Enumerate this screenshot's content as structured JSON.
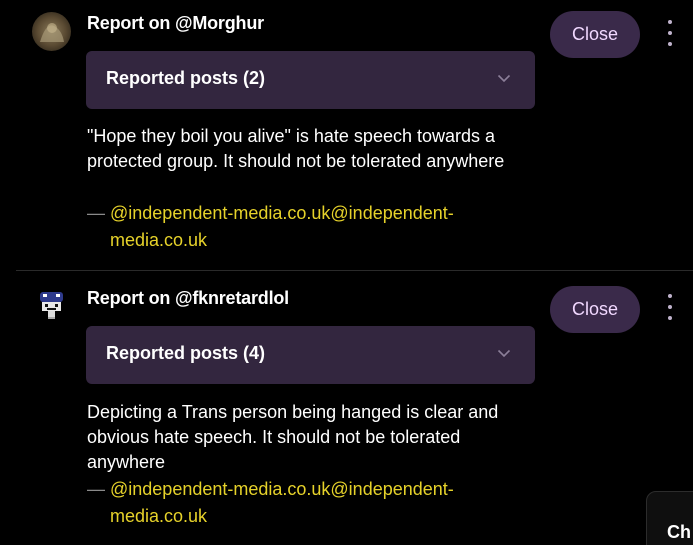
{
  "reports": [
    {
      "title": "Report on @Morghur",
      "close_label": "Close",
      "accordion_label": "Reported posts (2)",
      "reason": "\"Hope they boil you alive\" is hate speech towards a protected group. It should not be tolerated anywhere",
      "byline_dash": "—",
      "byline_handle": "@independent-media.co.uk@independent-media.co.uk"
    },
    {
      "title": "Report on @fknretardlol",
      "close_label": "Close",
      "accordion_label": "Reported posts (4)",
      "reason": "Depicting a Trans person being hanged is clear and obvious hate speech. It should not be tolerated anywhere",
      "byline_dash": "—",
      "byline_handle": "@independent-media.co.uk@independent-media.co.uk"
    }
  ],
  "corner_card": {
    "label": "Ch"
  },
  "colors": {
    "background": "#000000",
    "close_button_bg": "#3a2a4a",
    "close_button_text": "#f1d8ff",
    "accordion_bg": "#33263f",
    "handle_link": "#e6d22a"
  },
  "icons": {
    "menu": "more-vertical-icon",
    "chevron": "chevron-down-icon"
  }
}
